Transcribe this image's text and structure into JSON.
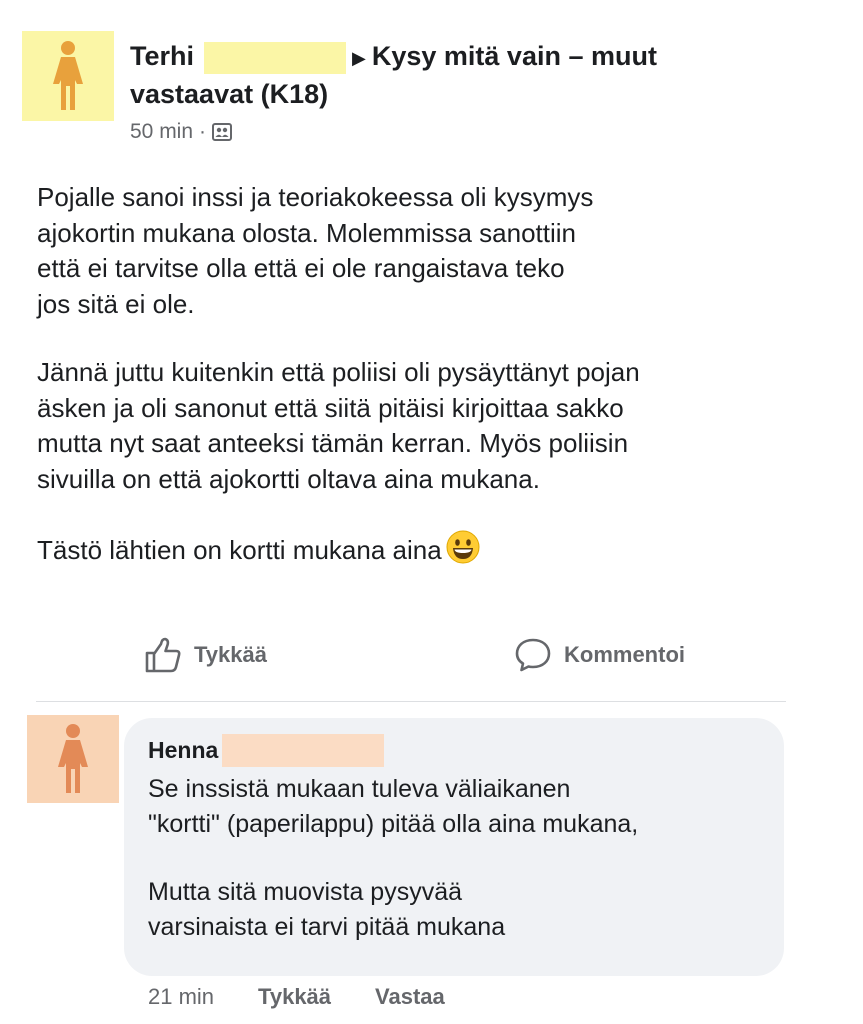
{
  "post": {
    "author": "Terhi",
    "group": "Kysy mitä vain – muut vastaavat  (K18)",
    "time": "50 min",
    "separator": "·",
    "paragraphs": [
      "Pojalle sanoi inssi ja teoriakokeessa oli kysymys\najokortin mukana olosta. Molemmissa sanottiin\nettä ei tarvitse olla että ei ole rangaistava teko\njos sitä ei ole.",
      "Jännä juttu kuitenkin että poliisi oli pysäyttänyt pojan\näsken ja oli sanonut että siitä pitäisi kirjoittaa sakko\nmutta nyt saat anteeksi tämän kerran. Myös poliisin\nsivuilla on että ajokortti oltava aina mukana."
    ],
    "last_line": "Tästö lähtien on kortti mukana aina",
    "avatar_color": "#fbf6a6",
    "avatar_icon": "woman-icon"
  },
  "actions": {
    "like_label": "Tykkää",
    "comment_label": "Kommentoi"
  },
  "comment": {
    "author": "Henna",
    "paragraphs": [
      "Se inssistä mukaan tuleva väliaikanen\n\"kortti\" (paperilappu) pitää olla aina mukana,",
      "Mutta sitä muovista pysyvää\nvarsinaista ei tarvi pitää mukana"
    ],
    "time": "21 min",
    "like_label": "Tykkää",
    "reply_label": "Vastaa",
    "avatar_color": "#f9d4b5",
    "avatar_icon": "woman-icon"
  }
}
